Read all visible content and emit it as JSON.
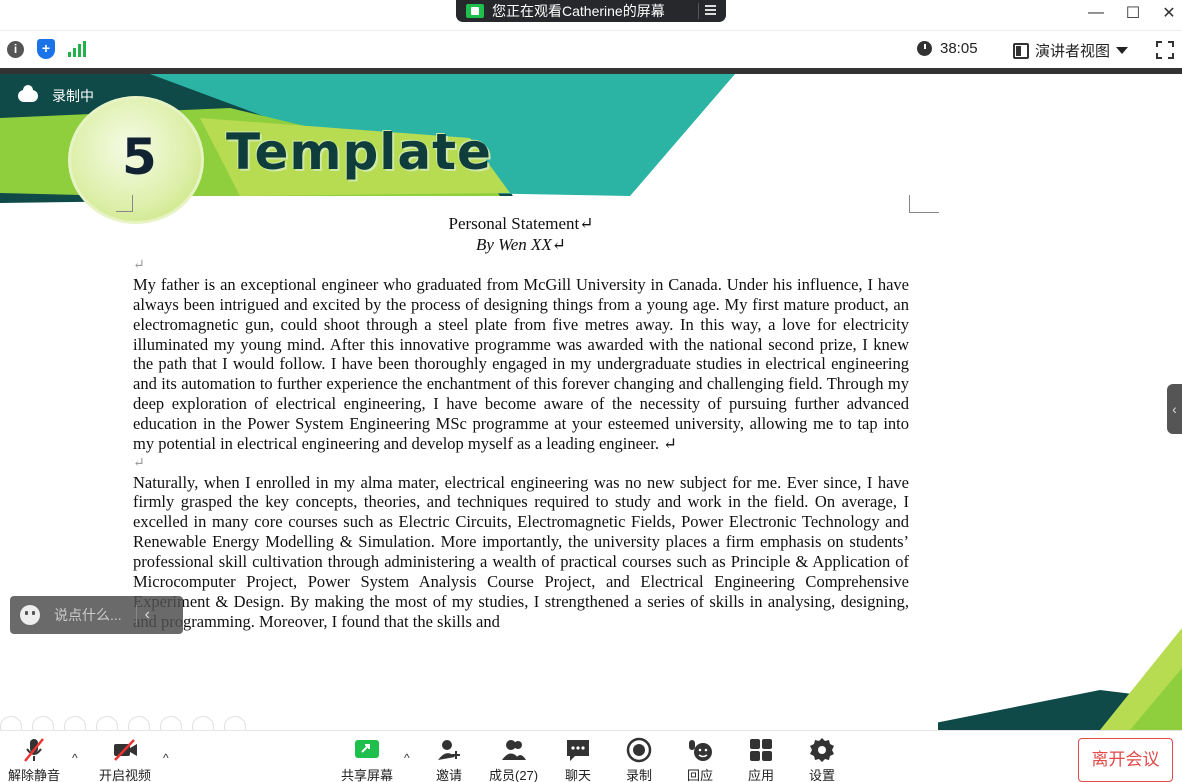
{
  "window": {
    "share_banner": "您正在观看Catherine的屏幕",
    "minimize": "—",
    "maximize": "☐",
    "close": "✕"
  },
  "infobar": {
    "info_icon": "i",
    "shield_icon": "+",
    "timer": "38:05",
    "view_label": "演讲者视图"
  },
  "shared": {
    "recording_label": "录制中",
    "slide_number": "5",
    "slide_title": "Template",
    "doc_title": "Personal Statement↵",
    "doc_byline": "By Wen XX↵",
    "para_mark": "↵",
    "paragraph1": "My father is an exceptional engineer who graduated from McGill University in Canada. Under his influence, I have always been intrigued and excited by the process of designing things from a young age. My first mature product, an electromagnetic gun, could shoot through a steel plate from five metres away. In this way, a love for electricity illuminated my young mind. After this innovative programme was awarded with the national second prize, I knew the path that I would follow. I have been thoroughly engaged in my undergraduate studies in electrical engineering and its automation to further experience the enchantment of this forever changing and challenging field. Through my deep exploration of electrical engineering, I have become aware of the necessity of pursuing further advanced education in the Power System Engineering MSc programme at your esteemed university, allowing me to tap into my potential in electrical engineering and develop myself as a leading engineer. ↵",
    "paragraph2": "Naturally, when I enrolled in my alma mater, electrical engineering was no new subject for me. Ever since, I have firmly grasped the key concepts, theories, and techniques required to study and work in the field. On average, I excelled in many core courses such as Electric Circuits, Electromagnetic Fields, Power Electronic Technology and Renewable Energy Modelling & Simulation. More importantly, the university places a firm emphasis on students’ professional skill cultivation through administering a wealth of practical courses such as Principle & Application of Microcomputer Project, Power System Analysis Course Project, and Electrical Engineering Comprehensive Experiment & Design.  By making the most of my studies, I strengthened a series of skills in analysing, designing, and programming. Moreover, I found that the skills and",
    "chat_placeholder": "说点什么...",
    "side_tab": "‹",
    "chat_collapse": "‹"
  },
  "toolbar": {
    "unmute": "解除静音",
    "start_video": "开启视频",
    "share_screen": "共享屏幕",
    "invite": "邀请",
    "participants": "成员(27)",
    "chat": "聊天",
    "record": "录制",
    "reactions": "回应",
    "apps": "应用",
    "settings": "设置",
    "leave": "离开会议",
    "caret": "^"
  },
  "colors": {
    "accent_green": "#22b14c",
    "leave_red": "#e34a4a",
    "dark_teal": "#0e3d3b",
    "lime": "#b7dc52"
  },
  "icons": [
    "screen-share-icon",
    "menu-icon",
    "info-icon",
    "shield-icon",
    "signal-icon",
    "clock-icon",
    "speaker-view-icon",
    "fullscreen-icon",
    "cloud-icon",
    "emoji-icon",
    "mic-muted-icon",
    "video-off-icon",
    "share-screen-icon",
    "invite-icon",
    "participants-icon",
    "chat-icon",
    "record-icon",
    "reactions-icon",
    "apps-icon",
    "settings-icon"
  ]
}
